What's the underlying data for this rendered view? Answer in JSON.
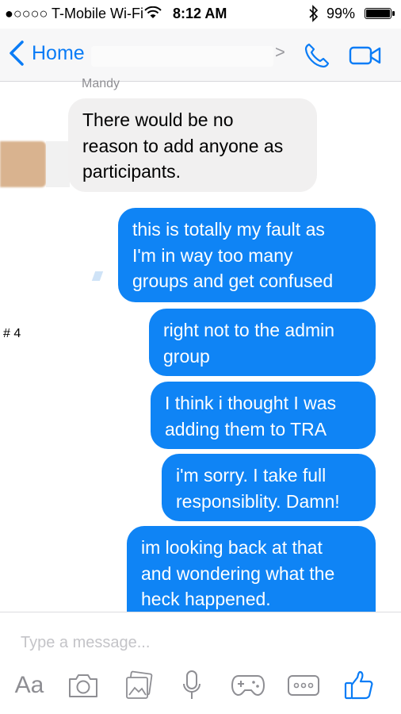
{
  "status_bar": {
    "carrier": "●○○○○ T-Mobile Wi-Fi",
    "time": "8:12 AM",
    "battery": "99%",
    "battery_level": 0.99
  },
  "nav": {
    "back_label": "Home",
    "accent_color": "#0a7cf6"
  },
  "conversation": {
    "sender_name": "Mandy",
    "side_marker": "# 4",
    "messages": [
      {
        "direction": "incoming",
        "text": "There would be no\nreason to add anyone as\nparticipants."
      },
      {
        "direction": "outgoing",
        "text": "this is totally my fault as\nI'm in way too many\ngroups and get confused"
      },
      {
        "direction": "outgoing",
        "text": "right not to the admin\ngroup"
      },
      {
        "direction": "outgoing",
        "text": "I think i thought I was\nadding them to TRA"
      },
      {
        "direction": "outgoing",
        "text": "i'm sorry. I take full\nresponsiblity. Damn!"
      },
      {
        "direction": "outgoing",
        "text": "im looking back at that\nand wondering what the\nheck happened."
      }
    ],
    "outgoing_color": "#0f84f5",
    "incoming_color": "#f1f0f0"
  },
  "composer": {
    "placeholder": "Type a message...",
    "text_tool_label": "Aa",
    "tools": [
      "camera-icon",
      "photo-icon",
      "microphone-icon",
      "game-controller-icon",
      "more-icon",
      "thumbs-up-icon"
    ]
  }
}
